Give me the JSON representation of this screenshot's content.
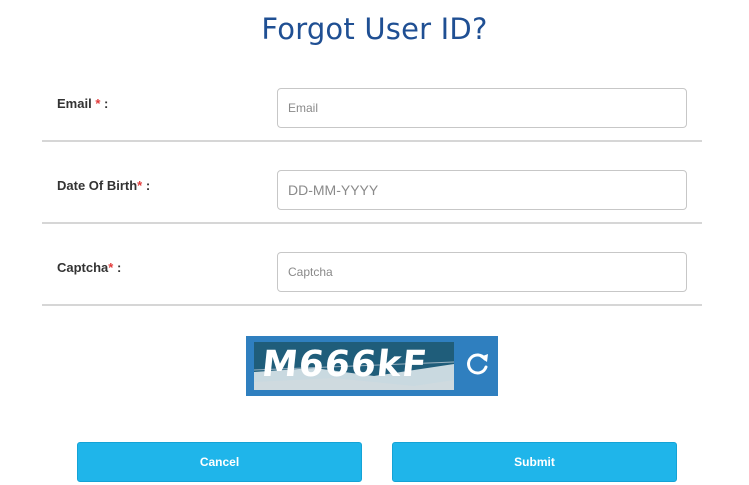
{
  "title": "Forgot User ID?",
  "form": {
    "email": {
      "label": "Email",
      "required_mark": "*",
      "suffix": " :",
      "placeholder": "Email",
      "value": ""
    },
    "dob": {
      "label": "Date Of Birth",
      "required_mark": "*",
      "suffix": " :",
      "placeholder": "DD-MM-YYYY",
      "value": ""
    },
    "captcha": {
      "label": "Captcha",
      "required_mark": "*",
      "suffix": " :",
      "placeholder": "Captcha",
      "value": ""
    }
  },
  "captcha_image": {
    "text": "M666kF",
    "refresh_icon": "refresh-icon"
  },
  "buttons": {
    "cancel": "Cancel",
    "submit": "Submit"
  },
  "colors": {
    "title": "#1f4f93",
    "required": "#e23a3a",
    "button": "#1fb5ea",
    "captcha_bg": "#2f7fbf"
  }
}
